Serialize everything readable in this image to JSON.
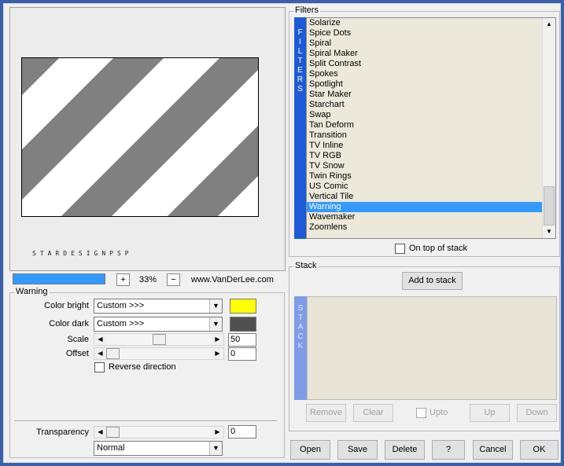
{
  "preview": {
    "watermark": "STARDESIGNPSP",
    "zoom": "33%",
    "zoom_in": "+",
    "zoom_out": "−",
    "website": "www.VanDerLee.com",
    "progress_fraction": 1.0
  },
  "warning_group": {
    "title": "Warning",
    "color_bright_label": "Color bright",
    "color_bright_value": "Custom >>>",
    "color_bright_swatch": "#ffff00",
    "color_dark_label": "Color dark",
    "color_dark_value": "Custom >>>",
    "color_dark_swatch": "#505050",
    "scale_label": "Scale",
    "scale_value": "50",
    "offset_label": "Offset",
    "offset_value": "0",
    "reverse_label": "Reverse direction",
    "reverse_checked": false
  },
  "transparency": {
    "label": "Transparency",
    "value": "0",
    "blend_mode": "Normal"
  },
  "filters": {
    "title": "Filters",
    "strip_letters": [
      "F",
      "I",
      "L",
      "T",
      "E",
      "R",
      "S"
    ],
    "items": [
      "Solarize",
      "Spice Dots",
      "Spiral",
      "Spiral Maker",
      "Split Contrast",
      "Spokes",
      "Spotlight",
      "Star Maker",
      "Starchart",
      "Swap",
      "Tan Deform",
      "Transition",
      "TV Inline",
      "TV RGB",
      "TV Snow",
      "Twin Rings",
      "US Comic",
      "Vertical Tile",
      "Warning",
      "Wavemaker",
      "Zoomlens"
    ],
    "selected": "Warning",
    "on_top_label": "On top of stack"
  },
  "stack": {
    "title": "Stack",
    "add_label": "Add to stack",
    "strip_letters": [
      "S",
      "T",
      "A",
      "C",
      "K"
    ],
    "remove_label": "Remove",
    "clear_label": "Clear",
    "upto_label": "Upto",
    "up_label": "Up",
    "down_label": "Down"
  },
  "footer": {
    "open": "Open",
    "save": "Save",
    "delete": "Delete",
    "help": "?",
    "cancel": "Cancel",
    "ok": "OK"
  },
  "colors": {
    "stripe_gray": "#808080",
    "list_select": "#3399ff",
    "filter_strip": "#1f5ad6",
    "stack_strip": "#7f9ce6"
  }
}
